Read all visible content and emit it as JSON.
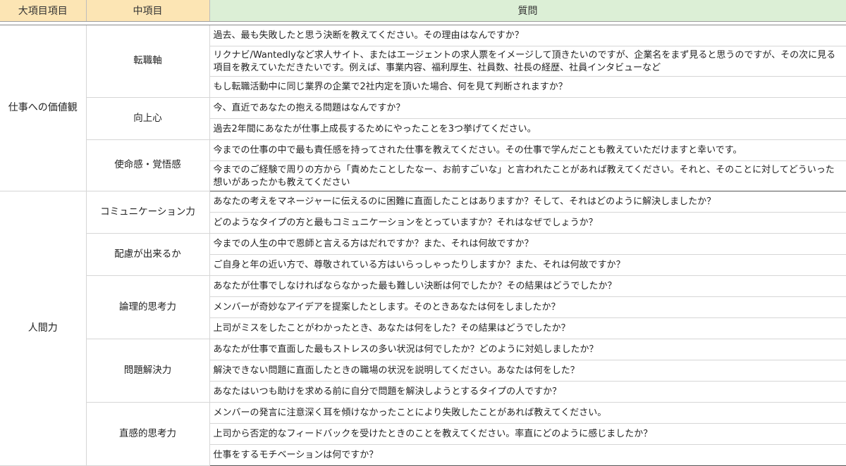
{
  "headers": {
    "major": "大項目項目",
    "mid": "中項目",
    "question": "質問"
  },
  "groups": [
    {
      "major": "仕事への価値観",
      "subs": [
        {
          "mid": "転職軸",
          "questions": [
            "過去、最も失敗したと思う決断を教えてください。その理由はなんですか？",
            "リクナビ/Wantedlyなど求人サイト、またはエージェントの求人票をイメージして頂きたいのですが、企業名をまず見ると思うのですが、その次に見る項目を教えていただきたいです。例えば、事業内容、福利厚生、社員数、社長の経歴、社員インタビューなど",
            "もし転職活動中に同じ業界の企業で2社内定を頂いた場合、何を見て判断されますか？"
          ]
        },
        {
          "mid": "向上心",
          "questions": [
            "今、直近であなたの抱える問題はなんですか？",
            "過去2年間にあなたが仕事上成長するためにやったことを3つ挙げてください。"
          ]
        },
        {
          "mid": "使命感・覚悟感",
          "questions": [
            "今までの仕事の中で最も責任感を持ってされた仕事を教えてください。その仕事で学んだことも教えていただけますと幸いです。",
            "今までのご経験で周りの方から「責めたことしたなー、お前すごいな」と言われたことがあれば教えてください。それと、そのことに対してどういった想いがあったかも教えてください"
          ]
        }
      ]
    },
    {
      "major": "人間力",
      "subs": [
        {
          "mid": "コミュニケーション力",
          "questions": [
            "あなたの考えをマネージャーに伝えるのに困難に直面したことはありますか？そして、それはどのように解決しましたか？",
            "どのようなタイプの方と最もコミュニケーションをとっていますか？それはなぜでしょうか？"
          ]
        },
        {
          "mid": "配慮が出来るか",
          "questions": [
            "今までの人生の中で恩師と言える方はだれですか？また、それは何故ですか？",
            "ご自身と年の近い方で、尊敬されている方はいらっしゃったりしますか？また、それは何故ですか？"
          ]
        },
        {
          "mid": "論理的思考力",
          "questions": [
            "あなたが仕事でしなければならなかった最も難しい決断は何でしたか？その結果はどうでしたか？",
            "メンバーが奇妙なアイデアを提案したとします。そのときあなたは何をしましたか？",
            "上司がミスをしたことがわかったとき、あなたは何をした？その結果はどうでしたか？"
          ]
        },
        {
          "mid": "問題解決力",
          "questions": [
            "あなたが仕事で直面した最もストレスの多い状況は何でしたか？どのように対処しましたか？",
            "解決できない問題に直面したときの職場の状況を説明してください。あなたは何をした？",
            "あなたはいつも助けを求める前に自分で問題を解決しようとするタイプの人ですか？"
          ]
        },
        {
          "mid": "直感的思考力",
          "questions": [
            "メンバーの発言に注意深く耳を傾けなかったことにより失敗したことがあれば教えてください。",
            "上司から否定的なフィードバックを受けたときのことを教えてください。率直にどのように感じましたか？",
            "仕事をするモチベーションは何ですか？"
          ]
        }
      ]
    }
  ]
}
